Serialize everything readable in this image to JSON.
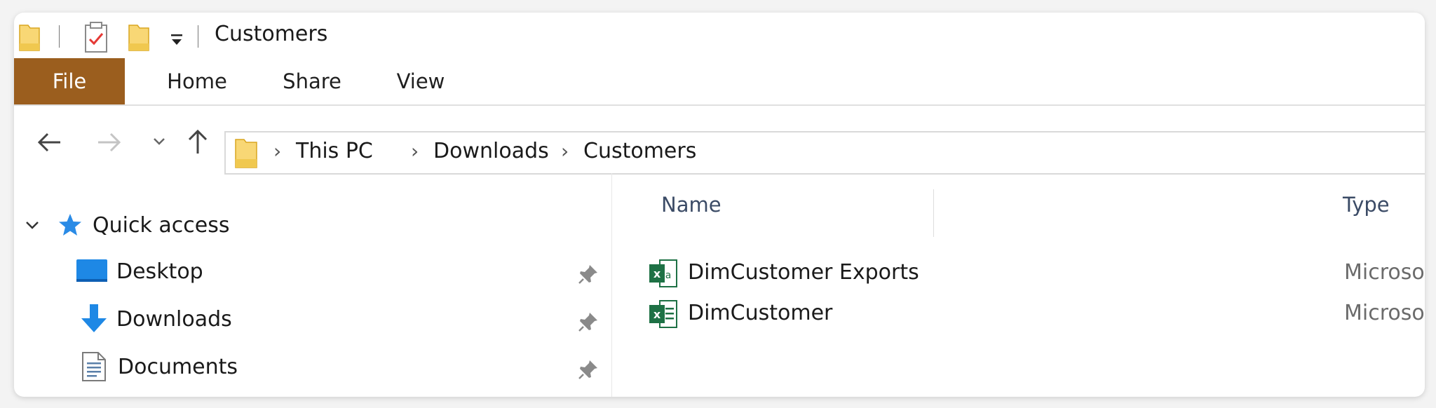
{
  "window": {
    "title": "Customers"
  },
  "ribbon": {
    "tabs": [
      {
        "label": "File"
      },
      {
        "label": "Home"
      },
      {
        "label": "Share"
      },
      {
        "label": "View"
      }
    ]
  },
  "address": {
    "crumbs": [
      "This PC",
      "Downloads",
      "Customers"
    ]
  },
  "nav_pane": {
    "quick_access": {
      "label": "Quick access"
    },
    "items": [
      {
        "label": "Desktop",
        "icon": "desktop-icon"
      },
      {
        "label": "Downloads",
        "icon": "downloads-icon"
      },
      {
        "label": "Documents",
        "icon": "documents-icon"
      }
    ]
  },
  "file_list": {
    "columns": [
      "Name",
      "Type"
    ],
    "rows": [
      {
        "name": "DimCustomer Exports",
        "type": "Microsoft Excel Comma Separated Values File",
        "icon": "excel-csv-icon"
      },
      {
        "name": "DimCustomer",
        "type": "Microsoft Excel Worksheet",
        "icon": "excel-worksheet-icon"
      }
    ]
  },
  "colors": {
    "file_tab": "#9b5e1e",
    "folder": "#f8d775",
    "excel_green": "#1e7145",
    "accent_blue": "#1e88e5"
  }
}
